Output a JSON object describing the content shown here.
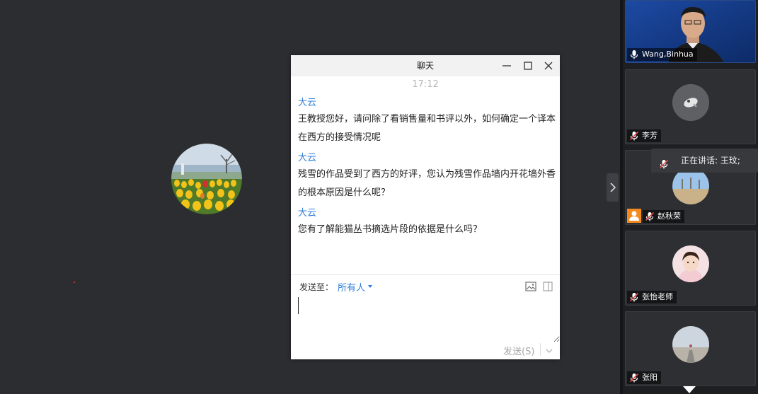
{
  "chat": {
    "title": "聊天",
    "timestamp": "17:12",
    "messages": [
      {
        "sender": "大云",
        "text": "王教授您好，请问除了看销售量和书评以外，如何确定一个译本在西方的接受情况呢"
      },
      {
        "sender": "大云",
        "text": "残雪的作品受到了西方的好评，您认为残雪作品墙内开花墙外香的根本原因是什么呢？"
      },
      {
        "sender": "大云",
        "text": "您有了解能猫丛书摘选片段的依据是什么吗？"
      }
    ],
    "send_to_label": "发送至：",
    "send_to_value": "所有人",
    "send_button": "发送(S)",
    "input_value": ""
  },
  "participants": [
    {
      "name": "Wang,Binhua",
      "mic": "on"
    },
    {
      "name": "李芳",
      "mic": "muted"
    },
    {
      "name": "赵秋荣",
      "mic": "muted"
    },
    {
      "name": "张怡老师",
      "mic": "muted"
    },
    {
      "name": "张阳",
      "mic": "muted"
    }
  ],
  "speaking_indicator": "正在讲话: 王玟;",
  "icons": {
    "minimize": "minimize-icon",
    "maximize": "maximize-icon",
    "close": "close-icon",
    "image": "image-icon",
    "screenshot": "screenshot-icon",
    "mic": "mic-icon",
    "collapse": "chevron-right-icon"
  },
  "colors": {
    "accent": "#2f7fd8",
    "background": "#2b2d30",
    "panel": "#1e1f21",
    "muted_mic": "#e04a4a"
  }
}
